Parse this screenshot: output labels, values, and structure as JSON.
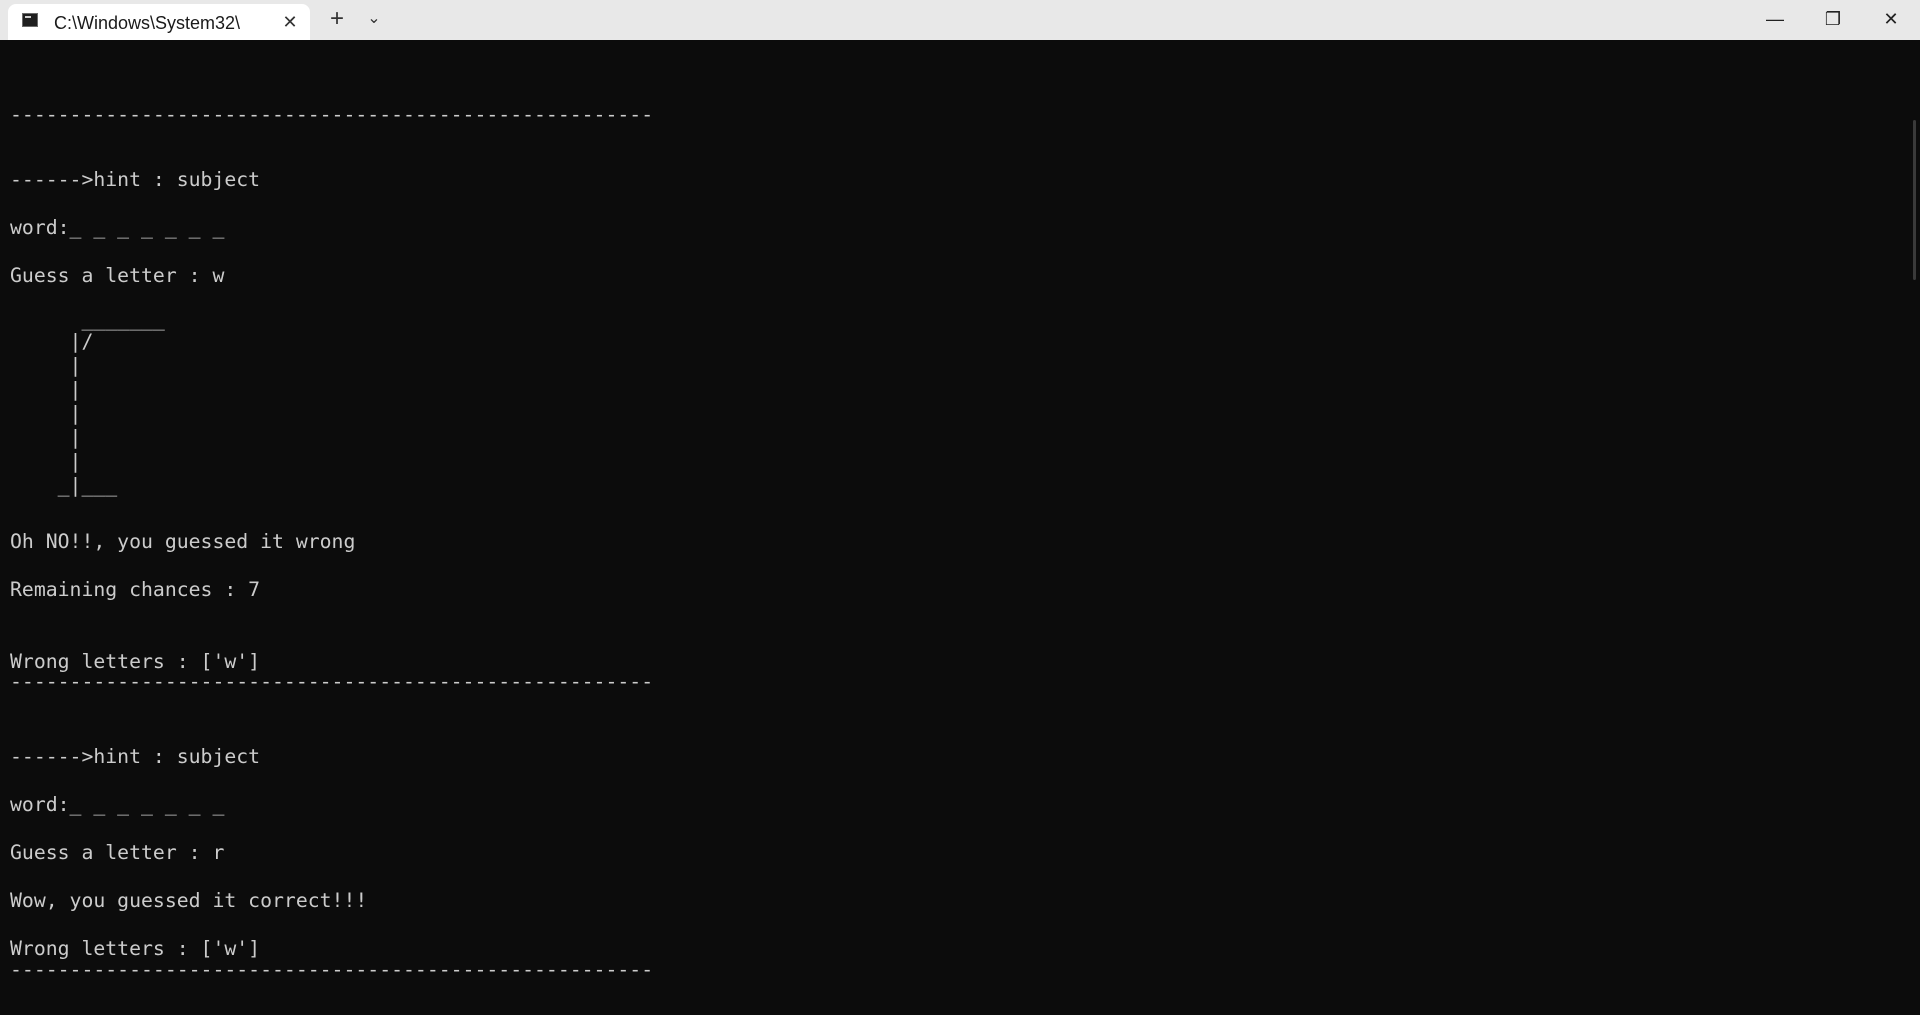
{
  "window": {
    "tab_title": "C:\\Windows\\System32\\",
    "tab_close": "✕",
    "new_tab": "+",
    "dropdown": "⌄",
    "minimize": "—",
    "maximize": "❐",
    "close": "✕"
  },
  "console": {
    "lines": [
      "------------------------------------------------------",
      "------>hint : subject",
      "word:_ _ _ _ _ _ _",
      "Guess a letter : w",
      "      _______",
      "     |/",
      "     |",
      "     |",
      "     |",
      "     |",
      "     |",
      "    _|___",
      "Oh NO!!, you guessed it wrong",
      "Remaining chances : 7",
      "Wrong letters : ['w']",
      "------------------------------------------------------",
      "------>hint : subject",
      "word:_ _ _ _ _ _ _",
      "Guess a letter : r",
      "Wow, you guessed it correct!!!",
      "Wrong letters : ['w']",
      "------------------------------------------------------"
    ]
  }
}
